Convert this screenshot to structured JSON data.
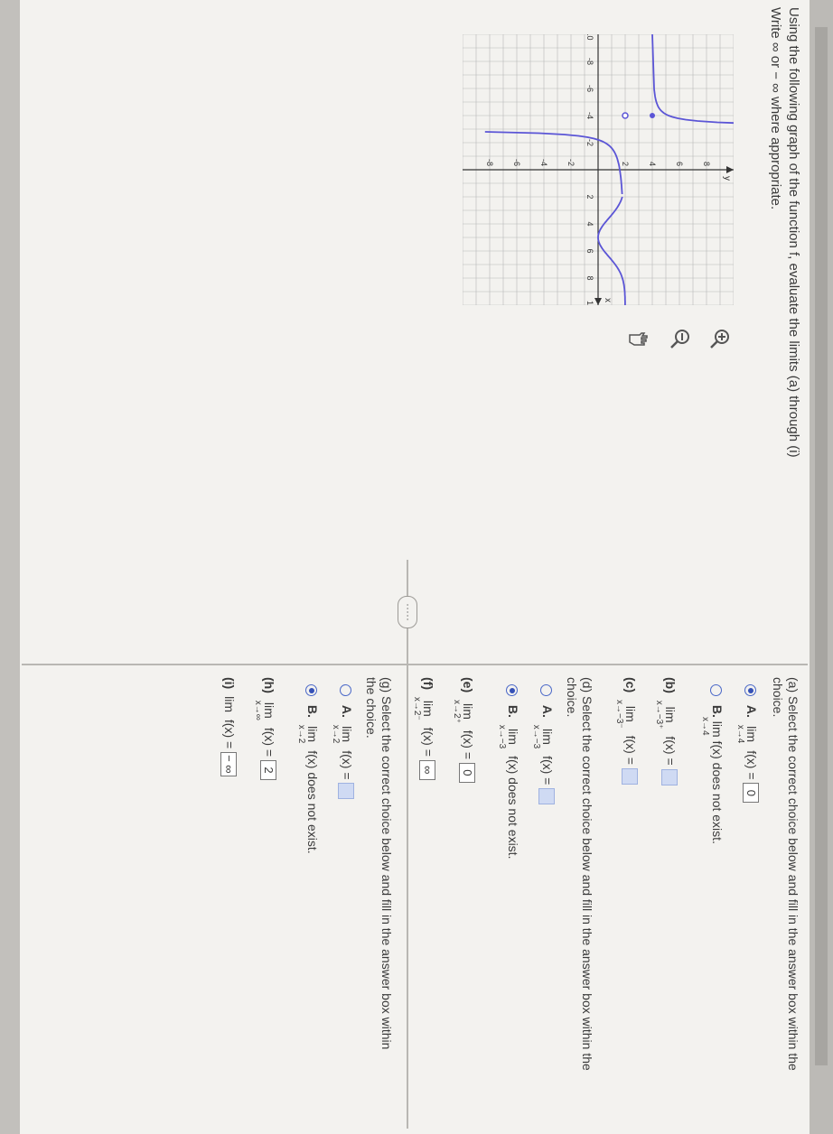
{
  "instructions": {
    "line1": "Using the following graph of the function f, evaluate the limits (a) through (i)",
    "line2": "Write ∞ or − ∞ where appropriate."
  },
  "graph": {
    "y_axis_label": "y",
    "x_axis_label": "x",
    "x_ticks": [
      "-10",
      "-8",
      "-6",
      "-4",
      "-2",
      "2",
      "4",
      "6",
      "8",
      "10"
    ],
    "y_ticks": [
      "8",
      "6",
      "4",
      "2",
      "-2",
      "-4",
      "-6",
      "-8"
    ],
    "curve_color": "#5b55d6"
  },
  "tools": {
    "zoom_in": "zoom-in",
    "zoom_out": "zoom-out",
    "pointer": "hand-pointer"
  },
  "divider_button": "·····",
  "parts": {
    "a": {
      "prompt": "(a) Select the correct choice below and fill in the answer box within the choice.",
      "option_a_label": "A.",
      "option_a_lim": "lim",
      "option_a_sub": "x→4",
      "option_a_fx": "f(x) =",
      "option_a_value": "0",
      "option_b_label": "B.",
      "option_b_text": "lim f(x) does not exist.",
      "option_b_sub": "x→4",
      "selected": "A"
    },
    "b": {
      "label": "(b)",
      "lim": "lim",
      "sub": "x→−3⁺",
      "fx": "f(x) =",
      "value": ""
    },
    "c": {
      "label": "(c)",
      "lim": "lim",
      "sub": "x→−3⁻",
      "fx": "f(x) =",
      "value": ""
    },
    "d": {
      "prompt": "(d) Select the correct choice below and fill in the answer box within the choice.",
      "option_a_label": "A.",
      "option_a_lim": "lim",
      "option_a_sub": "x→−3",
      "option_a_fx": "f(x) =",
      "option_a_value": "",
      "option_b_label": "B.",
      "option_b_lim": "lim",
      "option_b_sub": "x→−3",
      "option_b_text": "f(x) does not exist.",
      "selected": "B"
    },
    "e": {
      "label": "(e)",
      "lim": "lim",
      "sub": "x→2⁺",
      "fx": "f(x) =",
      "value": "0"
    },
    "f": {
      "label": "(f)",
      "lim": "lim",
      "sub": "x→2⁻",
      "fx": "f(x) =",
      "value": "∞"
    },
    "g": {
      "prompt_line1": "(g) Select the correct choice below and fill in the answer box within",
      "prompt_line2": "the choice.",
      "option_a_label": "A.",
      "option_a_lim": "lim",
      "option_a_sub": "x→2",
      "option_a_fx": "f(x) =",
      "option_a_value": "",
      "option_b_label": "B.",
      "option_b_lim": "lim",
      "option_b_sub": "x→2",
      "option_b_text": "f(x) does not exist.",
      "selected": "B"
    },
    "h": {
      "label": "(h)",
      "lim": "lim",
      "sub": "x→∞",
      "fx": "f(x) =",
      "value": "2"
    },
    "i": {
      "label": "(i)",
      "lim": "lim",
      "fx": "f(x) =",
      "value": "− ∞"
    }
  }
}
